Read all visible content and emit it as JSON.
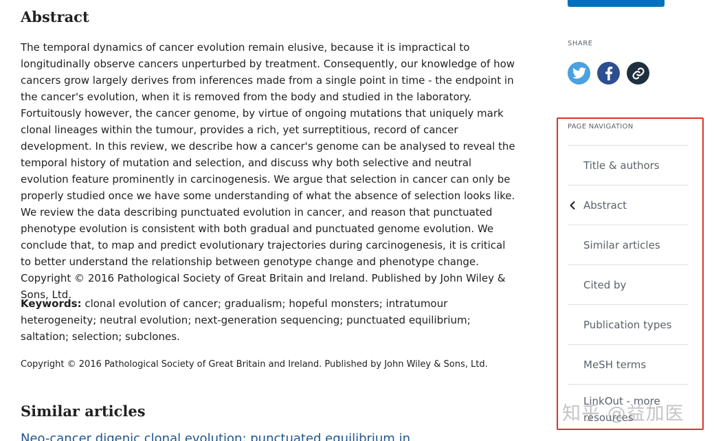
{
  "abstract": {
    "title": "Abstract",
    "text": "The temporal dynamics of cancer evolution remain elusive, because it is impractical to longitudinally observe cancers unperturbed by treatment. Consequently, our knowledge of how cancers grow largely derives from inferences made from a single point in time - the endpoint in the cancer's evolution, when it is removed from the body and studied in the laboratory. Fortuitously however, the cancer genome, by virtue of ongoing mutations that uniquely mark clonal lineages within the tumour, provides a rich, yet surreptitious, record of cancer development. In this review, we describe how a cancer's genome can be analysed to reveal the temporal history of mutation and selection, and discuss why both selective and neutral evolution feature prominently in carcinogenesis. We argue that selection in cancer can only be properly studied once we have some understanding of what the absence of selection looks like. We review the data describing punctuated evolution in cancer, and reason that punctuated phenotype evolution is consistent with both gradual and punctuated genome evolution. We conclude that, to map and predict evolutionary trajectories during carcinogenesis, it is critical to better understand the relationship between genotype change and phenotype change. Copyright © 2016 Pathological Society of Great Britain and Ireland. Published by John Wiley & Sons, Ltd.",
    "keywords_label": "Keywords:",
    "keywords": "clonal evolution of cancer; gradualism; hopeful monsters; intratumour heterogeneity; neutral evolution; next-generation sequencing; punctuated equilibrium; saltation; selection; subclones.",
    "copyright": "Copyright © 2016 Pathological Society of Great Britain and Ireland. Published by John Wiley & Sons, Ltd."
  },
  "similar": {
    "title": "Similar articles",
    "first_link_partial": "Neo-cancer digenic clonal evolution: punctuated equilibrium in"
  },
  "share": {
    "label": "SHARE",
    "buttons": [
      {
        "name": "twitter-icon",
        "color": "#4ba0e0"
      },
      {
        "name": "facebook-icon",
        "color": "#2e4f8f"
      },
      {
        "name": "link-icon",
        "color": "#1f2f40"
      }
    ]
  },
  "page_nav": {
    "label": "PAGE NAVIGATION",
    "items": [
      {
        "label": "Title & authors",
        "active": false
      },
      {
        "label": "Abstract",
        "active": true
      },
      {
        "label": "Similar articles",
        "active": false
      },
      {
        "label": "Cited by",
        "active": false
      },
      {
        "label": "Publication types",
        "active": false
      },
      {
        "label": "MeSH terms",
        "active": false
      },
      {
        "label": "LinkOut - more resources",
        "active": false
      }
    ]
  },
  "watermark": "知乎 @益加医",
  "colors": {
    "highlight_border": "#d9322b",
    "primary_button": "#0071bc",
    "link": "#20558a"
  }
}
